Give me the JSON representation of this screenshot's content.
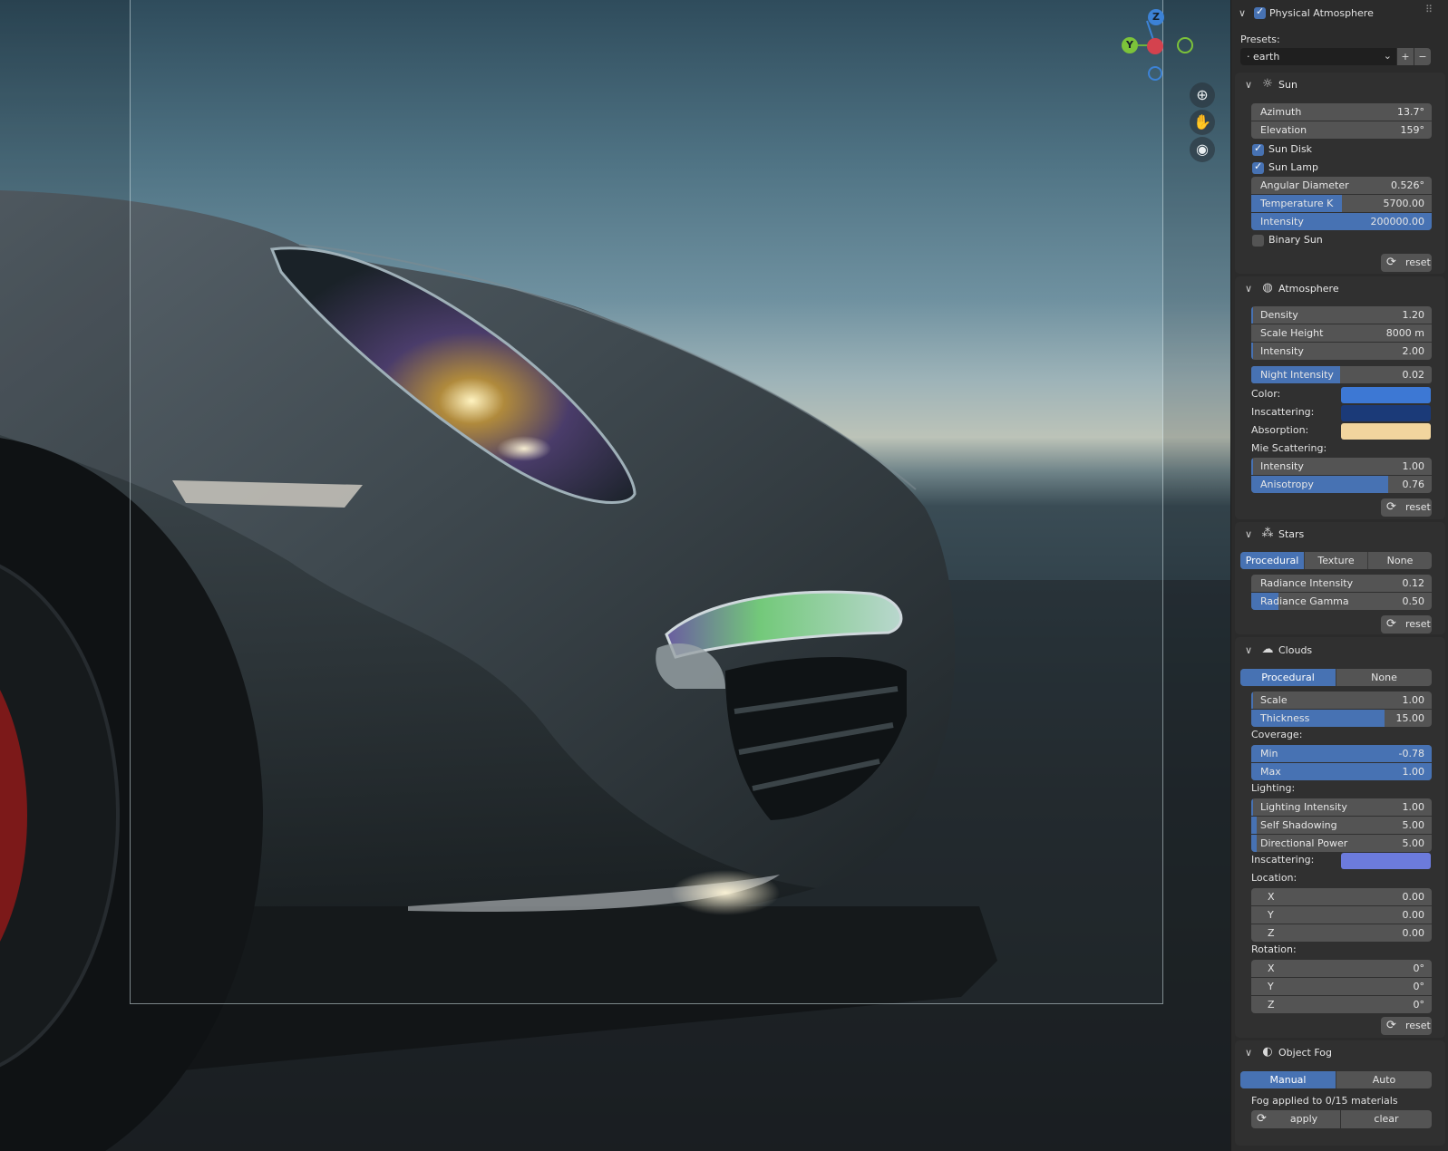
{
  "panel": {
    "title": "Physical Atmosphere",
    "enabled": true,
    "presets_label": "Presets:",
    "preset_value": "· earth",
    "add_preset": "+",
    "remove_preset": "−"
  },
  "sun": {
    "header": "Sun",
    "azimuth": {
      "label": "Azimuth",
      "value": "13.7°"
    },
    "elevation": {
      "label": "Elevation",
      "value": "159°"
    },
    "sun_disk": {
      "label": "Sun Disk",
      "checked": true
    },
    "sun_lamp": {
      "label": "Sun Lamp",
      "checked": true
    },
    "angular_diameter": {
      "label": "Angular Diameter",
      "value": "0.526°"
    },
    "temperature": {
      "label": "Temperature K",
      "value": "5700.00",
      "fill": 0.5
    },
    "intensity": {
      "label": "Intensity",
      "value": "200000.00",
      "fill": 1.0
    },
    "binary_sun": {
      "label": "Binary Sun",
      "checked": false
    },
    "reset": "reset"
  },
  "atmosphere": {
    "header": "Atmosphere",
    "density": {
      "label": "Density",
      "value": "1.20"
    },
    "scale_height": {
      "label": "Scale Height",
      "value": "8000 m"
    },
    "intensity": {
      "label": "Intensity",
      "value": "2.00"
    },
    "night_intensity": {
      "label": "Night Intensity",
      "value": "0.02",
      "fill": 0.49
    },
    "color_label": "Color:",
    "inscattering_label": "Inscattering:",
    "absorption_label": "Absorption:",
    "color": "#3d78d4",
    "inscattering": "#1b3a78",
    "absorption": "#f1d59e",
    "mie_label": "Mie Scattering:",
    "mie_intensity": {
      "label": "Intensity",
      "value": "1.00"
    },
    "anisotropy": {
      "label": "Anisotropy",
      "value": "0.76",
      "fill": 0.76
    },
    "reset": "reset"
  },
  "stars": {
    "header": "Stars",
    "tabs": [
      "Procedural",
      "Texture",
      "None"
    ],
    "active_tab": 0,
    "radiance_intensity": {
      "label": "Radiance Intensity",
      "value": "0.12"
    },
    "radiance_gamma": {
      "label": "Radiance Gamma",
      "value": "0.50",
      "fill": 0.15
    },
    "reset": "reset"
  },
  "clouds": {
    "header": "Clouds",
    "tabs": [
      "Procedural",
      "None"
    ],
    "active_tab": 0,
    "scale": {
      "label": "Scale",
      "value": "1.00"
    },
    "thickness": {
      "label": "Thickness",
      "value": "15.00",
      "fill": 0.74
    },
    "coverage_label": "Coverage:",
    "min": {
      "label": "Min",
      "value": "-0.78",
      "fill": 1.0
    },
    "max": {
      "label": "Max",
      "value": "1.00",
      "fill": 1.0
    },
    "lighting_label": "Lighting:",
    "lighting_intensity": {
      "label": "Lighting Intensity",
      "value": "1.00"
    },
    "self_shadowing": {
      "label": "Self Shadowing",
      "value": "5.00"
    },
    "directional_power": {
      "label": "Directional Power",
      "value": "5.00"
    },
    "inscattering_label": "Inscattering:",
    "inscattering_color": "#6c7bdc",
    "location_label": "Location:",
    "location": [
      {
        "axis": "X",
        "value": "0.00"
      },
      {
        "axis": "Y",
        "value": "0.00"
      },
      {
        "axis": "Z",
        "value": "0.00"
      }
    ],
    "rotation_label": "Rotation:",
    "rotation": [
      {
        "axis": "X",
        "value": "0°"
      },
      {
        "axis": "Y",
        "value": "0°"
      },
      {
        "axis": "Z",
        "value": "0°"
      }
    ],
    "reset": "reset"
  },
  "object_fog": {
    "header": "Object Fog",
    "tabs": [
      "Manual",
      "Auto"
    ],
    "active_tab": 0,
    "status": "Fog applied to 0/15 materials",
    "apply": "apply",
    "clear": "clear"
  },
  "gizmo": {
    "x": "X",
    "y": "Y",
    "z": "Z"
  }
}
